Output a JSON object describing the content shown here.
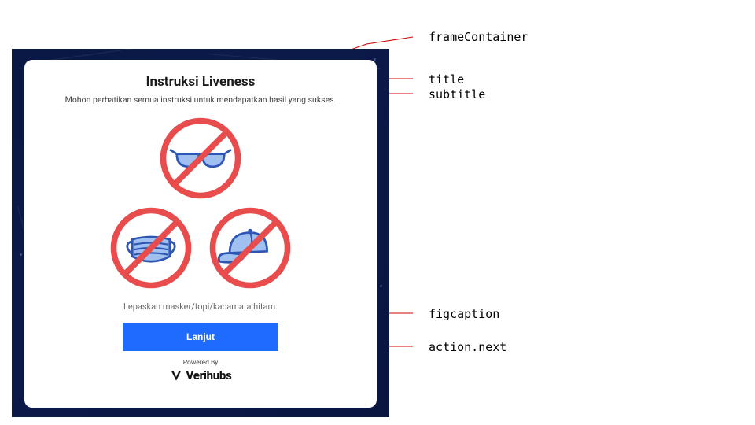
{
  "modal": {
    "title": "Instruksi Liveness",
    "subtitle": "Mohon perhatikan semua instruksi untuk mendapatkan hasil yang sukses.",
    "figcaption": "Lepaskan masker/topi/kacamata hitam.",
    "action": {
      "next": "Lanjut"
    },
    "powered_by_label": "Powered By",
    "brand_name": "Verihubs"
  },
  "annotations": {
    "frameContainer": "frameContainer",
    "title": "title",
    "subtitle": "subtitle",
    "figcaption": "figcaption",
    "action_next": "action.next"
  },
  "icons": {
    "sunglasses": "no-sunglasses-icon",
    "mask": "no-mask-icon",
    "cap": "no-cap-icon"
  },
  "colors": {
    "frame_bg": "#0a1845",
    "primary_button": "#1f6bff",
    "prohibit_ring": "#e84c4c",
    "icon_fill": "#9fc0f0",
    "icon_stroke": "#2e56b5"
  }
}
